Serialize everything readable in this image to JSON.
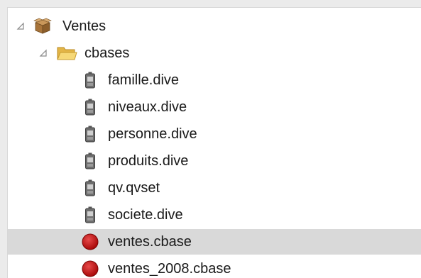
{
  "tree": {
    "root": {
      "label": "Ventes",
      "icon": "package-icon",
      "expanded": true
    },
    "folder": {
      "label": "cbases",
      "icon": "folder-open-icon",
      "expanded": true
    },
    "items": [
      {
        "label": "famille.dive",
        "icon": "dive-file-icon"
      },
      {
        "label": "niveaux.dive",
        "icon": "dive-file-icon"
      },
      {
        "label": "personne.dive",
        "icon": "dive-file-icon"
      },
      {
        "label": "produits.dive",
        "icon": "dive-file-icon"
      },
      {
        "label": "qv.qvset",
        "icon": "dive-file-icon"
      },
      {
        "label": "societe.dive",
        "icon": "dive-file-icon"
      },
      {
        "label": "ventes.cbase",
        "icon": "cbase-icon",
        "selected": true
      },
      {
        "label": "ventes_2008.cbase",
        "icon": "cbase-icon"
      }
    ]
  },
  "colors": {
    "selection": "#d9d9d9",
    "cbase_red": "#c40f0f",
    "folder_yellow": "#f3cf6a"
  }
}
